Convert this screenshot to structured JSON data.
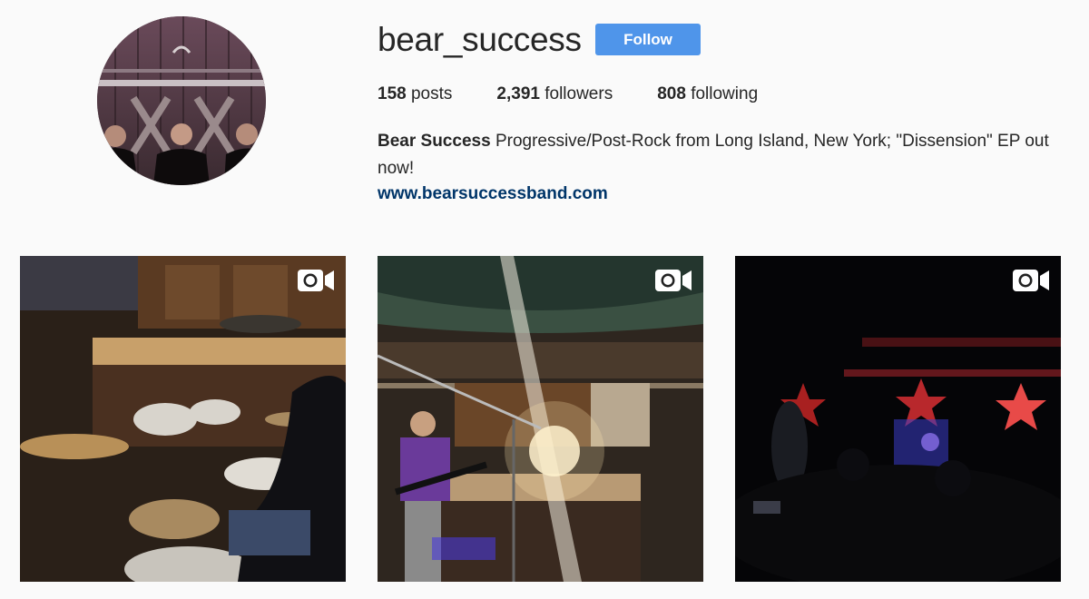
{
  "profile": {
    "username": "bear_success",
    "follow_label": "Follow",
    "stats": {
      "posts_count": "158",
      "posts_label": "posts",
      "followers_count": "2,391",
      "followers_label": "followers",
      "following_count": "808",
      "following_label": "following"
    },
    "bio": {
      "name": "Bear Success",
      "text": "Progressive/Post-Rock from Long Island, New York; \"Dissension\" EP out now!",
      "link": "www.bearsuccessband.com"
    }
  },
  "posts": [
    {
      "type": "video",
      "icon": "video-camera-icon",
      "subject": "drum kit in kitchen"
    },
    {
      "type": "video",
      "icon": "video-camera-icon",
      "subject": "guitarist with bright light"
    },
    {
      "type": "video",
      "icon": "video-camera-icon",
      "subject": "concert stage with red stars"
    }
  ],
  "colors": {
    "background": "#fafafa",
    "follow_button": "#4f95ea",
    "link": "#003569",
    "text": "#262626"
  }
}
